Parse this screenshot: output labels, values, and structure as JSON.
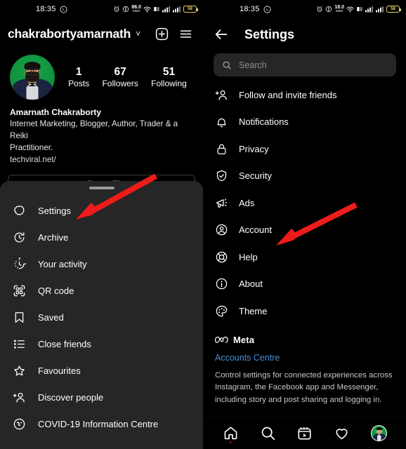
{
  "status_bar": {
    "time": "18:35",
    "whatsapp_icon": "whatsapp-icon",
    "alarm_icon": "alarm-icon",
    "dnd_icon": "do-not-disturb-icon",
    "net_speed_value": "86.0",
    "net_speed_unit": "KB/S",
    "net_speed_value_right": "18.0",
    "net_speed_unit_right": "KB/S",
    "wifi_icon": "wifi-icon",
    "vpn_icon": "vpn-icon",
    "signal_icon": "signal-bars-icon",
    "battery_level": "58"
  },
  "profile": {
    "username": "chakrabortyamarnath",
    "chevron": "˅",
    "add_label": "+",
    "stats": [
      {
        "num": "1",
        "label": "Posts"
      },
      {
        "num": "67",
        "label": "Followers"
      },
      {
        "num": "51",
        "label": "Following"
      }
    ],
    "display_name": "Amarnath Chakraborty",
    "bio_line1": "Internet Marketing, Blogger, Author, Trader & a Reiki",
    "bio_line2": "Practitioner.",
    "website": "techviral.net/",
    "edit_profile_label": "Edit Profile"
  },
  "sheet_menu": {
    "items": [
      {
        "icon": "settings-gear-icon",
        "label": "Settings"
      },
      {
        "icon": "archive-clock-icon",
        "label": "Archive"
      },
      {
        "icon": "your-activity-clock-icon",
        "label": "Your activity"
      },
      {
        "icon": "qr-code-icon",
        "label": "QR code"
      },
      {
        "icon": "saved-bookmark-icon",
        "label": "Saved"
      },
      {
        "icon": "close-friends-list-icon",
        "label": "Close friends"
      },
      {
        "icon": "favourites-star-icon",
        "label": "Favourites"
      },
      {
        "icon": "discover-people-icon",
        "label": "Discover people"
      },
      {
        "icon": "covid-info-icon",
        "label": "COVID-19 Information Centre"
      }
    ]
  },
  "settings": {
    "back_icon": "back-arrow-icon",
    "title": "Settings",
    "search_placeholder": "Search",
    "search_icon": "search-icon",
    "items": [
      {
        "icon": "follow-invite-friends-icon",
        "label": "Follow and invite friends"
      },
      {
        "icon": "notifications-bell-icon",
        "label": "Notifications"
      },
      {
        "icon": "privacy-lock-icon",
        "label": "Privacy"
      },
      {
        "icon": "security-shield-icon",
        "label": "Security"
      },
      {
        "icon": "ads-megaphone-icon",
        "label": "Ads"
      },
      {
        "icon": "account-person-icon",
        "label": "Account"
      },
      {
        "icon": "help-lifebuoy-icon",
        "label": "Help"
      },
      {
        "icon": "about-info-icon",
        "label": "About"
      },
      {
        "icon": "theme-palette-icon",
        "label": "Theme"
      }
    ],
    "meta": {
      "brand_icon": "meta-infinity-icon",
      "brand_name": "Meta",
      "link_label": "Accounts Centre",
      "description_line1": "Control settings for connected experiences across",
      "description_line2": "Instagram, the Facebook app and Messenger,",
      "description_line3": "including story and post sharing and logging in."
    }
  },
  "bottom_nav": {
    "items": [
      {
        "icon": "home-icon",
        "label": "Home",
        "active": true
      },
      {
        "icon": "search-icon",
        "label": "Search",
        "active": false
      },
      {
        "icon": "reels-icon",
        "label": "Reels",
        "active": false
      },
      {
        "icon": "heart-icon",
        "label": "Activity",
        "active": false
      },
      {
        "icon": "profile-avatar-icon",
        "label": "Profile",
        "active": false
      }
    ]
  },
  "annotations": {
    "accent_color": "#ee1b1b",
    "arrow_left_target": "Settings",
    "arrow_right_target": "Account"
  }
}
